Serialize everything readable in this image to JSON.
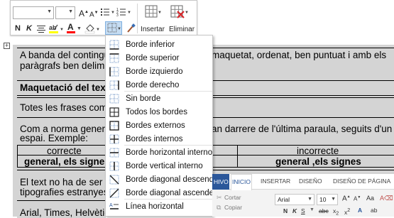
{
  "mini_toolbar": {
    "grow_font": "A",
    "shrink_font": "A",
    "bold": "N",
    "italic": "K",
    "font_color": "A",
    "insert_label": "Insertar",
    "delete_label": "Eliminar"
  },
  "table_handle": "+",
  "document": {
    "row1_line1": "A banda del contingut,",
    "row1_line1_right": "maquetat, ordenat, ben puntuat i amb els",
    "row1_line2": "paràgrafs ben delimita",
    "row2": "Maquetació del text",
    "row3": "Totes les frases come",
    "row4_line1": "Com a norma general,",
    "row4_line1_right": "an darrere de l'última paraula, seguits d'un",
    "row4_line2": "espai. Exemple:",
    "col_left_header": "correcte",
    "col_right_header": "incorrecte",
    "col_left_value": "general, els signes",
    "col_right_value": "general ,els signes",
    "row6_line1": "El text no ha de ser m",
    "row6_line2": "tipografies estranyes.",
    "row7": "Arial, Times, Helvètica"
  },
  "borders_menu": {
    "items": [
      {
        "label": "Borde inferior",
        "icon": "border-bottom-icon"
      },
      {
        "label": "Borde superior",
        "icon": "border-top-icon"
      },
      {
        "label": "Borde izquierdo",
        "icon": "border-left-icon"
      },
      {
        "label": "Borde derecho",
        "icon": "border-right-icon"
      },
      {
        "label": "Sin borde",
        "icon": "no-border-icon"
      },
      {
        "label": "Todos los bordes",
        "icon": "all-borders-icon"
      },
      {
        "label": "Bordes externos",
        "icon": "outside-borders-icon"
      },
      {
        "label": "Bordes internos",
        "icon": "inside-borders-icon"
      },
      {
        "label": "Borde horizontal interno",
        "icon": "inside-horizontal-border-icon"
      },
      {
        "label": "Borde vertical interno",
        "icon": "inside-vertical-border-icon"
      },
      {
        "label": "Borde diagonal descendente",
        "icon": "diagonal-down-border-icon"
      },
      {
        "label": "Borde diagonal ascendente",
        "icon": "diagonal-up-border-icon"
      },
      {
        "label": "Línea horizontal",
        "icon": "horizontal-line-icon"
      }
    ]
  },
  "ribbon": {
    "file_tab": "HIVO",
    "tabs": [
      "INICIO",
      "INSERTAR",
      "DISEÑO",
      "DISEÑO DE PÁGINA"
    ],
    "cut": "Cortar",
    "copy": "Copiar",
    "font_name": "Arial",
    "font_size": "10",
    "bold": "N",
    "italic": "K",
    "underline": "S",
    "change_case": "Aa"
  },
  "colors": {
    "accent": "#2b579a",
    "table_bg": "#d4d4d4",
    "highlight_yellow": "#ffff00",
    "font_red": "#ff0000"
  }
}
